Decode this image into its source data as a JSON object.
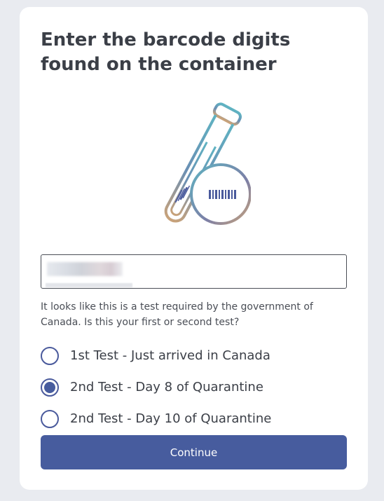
{
  "page": {
    "title": "Enter the barcode digits found on the container"
  },
  "barcode_input": {
    "value": ""
  },
  "question": {
    "text": "It looks like this is a test required by the government of Canada. Is this your first or second test?"
  },
  "options": [
    {
      "label": "1st Test - Just arrived in Canada",
      "selected": false
    },
    {
      "label": "2nd Test - Day 8 of Quarantine",
      "selected": true
    },
    {
      "label": "2nd Test - Day 10 of Quarantine",
      "selected": false
    }
  ],
  "continue_button": {
    "label": "Continue"
  },
  "colors": {
    "accent": "#475c9e",
    "background": "#e9ebf0",
    "card": "#ffffff",
    "text": "#3b3f47",
    "illustration_teal": "#5fb3c2",
    "illustration_tan": "#c8a27a",
    "illustration_navy": "#4a5a9c"
  }
}
